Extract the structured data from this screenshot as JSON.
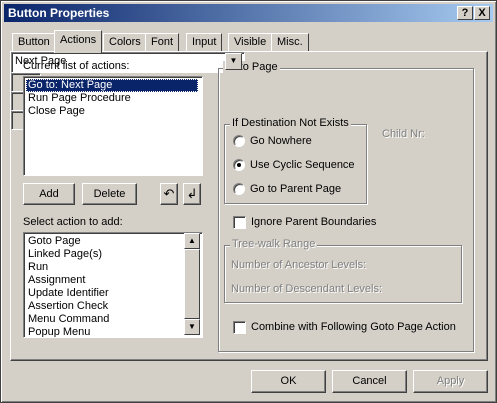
{
  "window": {
    "title": "Button Properties",
    "help_label": "?",
    "close_label": "X"
  },
  "tabs": [
    {
      "label": "Button",
      "active": false
    },
    {
      "label": "Actions",
      "active": true
    },
    {
      "label": "Colors",
      "active": false
    },
    {
      "label": "Font",
      "active": false
    },
    {
      "label": "Input",
      "active": false
    },
    {
      "label": "Visible",
      "active": false
    },
    {
      "label": "Misc.",
      "active": false
    }
  ],
  "current_actions": {
    "label": "Current list of actions:",
    "items": [
      "Go to: Next Page",
      "Run Page Procedure",
      "Close Page"
    ],
    "selected_index": 0
  },
  "buttons": {
    "add": "Add",
    "delete": "Delete",
    "up_icon": "↶",
    "down_icon": "↲"
  },
  "add_actions": {
    "label": "Select action to add:",
    "items": [
      "Goto Page",
      "Linked Page(s)",
      "Run",
      "Assignment",
      "Update Identifier",
      "Assertion Check",
      "Menu Command",
      "Popup Menu"
    ]
  },
  "goto_page": {
    "legend": "Goto Page",
    "dropdown_value": "Next Page",
    "if_dest": {
      "legend": "If Destination Not Exists",
      "options": [
        "Go Nowhere",
        "Use Cyclic Sequence",
        "Go to Parent Page"
      ],
      "selected": 1
    },
    "child_nr_label": "Child Nr:",
    "ignore_parent": {
      "label": "Ignore Parent Boundaries",
      "checked": false
    },
    "tree_walk": {
      "legend": "Tree-walk Range",
      "ancestor_label": "Number of Ancestor Levels:",
      "descendant_label": "Number of Descendant Levels:"
    },
    "combine": {
      "label": "Combine with Following Goto Page Action",
      "checked": false
    }
  },
  "footer": {
    "ok": "OK",
    "cancel": "Cancel",
    "apply": "Apply"
  },
  "colors": {
    "selection": "#0a246a",
    "face": "#d4d0c8"
  }
}
